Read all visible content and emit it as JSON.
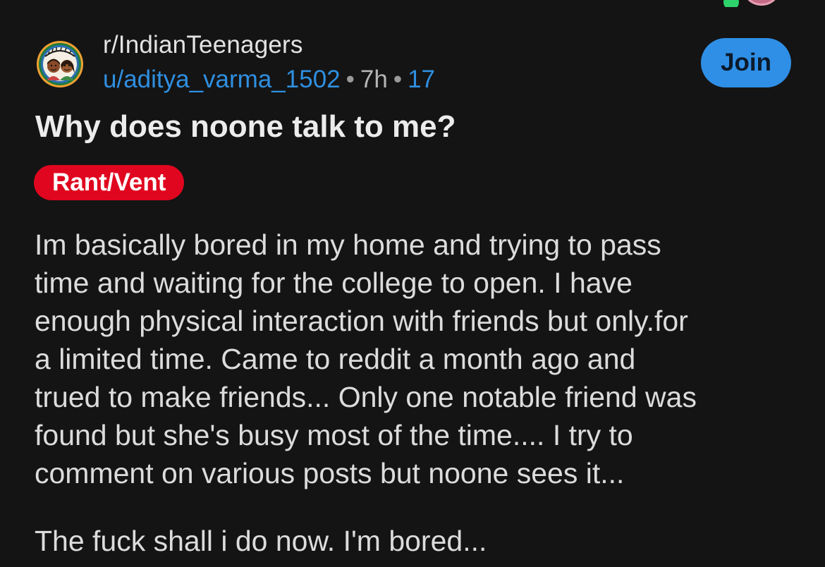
{
  "colors": {
    "background": "#141414",
    "link": "#2f8fe0",
    "join_button": "#2f8fe6",
    "flair": "#e0061f"
  },
  "header": {
    "subreddit": "r/IndianTeenagers",
    "author": "u/aditya_varma_1502",
    "separator": "•",
    "age": "7h",
    "count": "17",
    "join_label": "Join"
  },
  "post": {
    "title": "Why does noone talk to me?",
    "flair": "Rant/Vent",
    "body_lines": [
      "Im basically bored in my home and trying to pass",
      "time and waiting for the college to open. I have",
      "enough physical interaction with friends but only.for",
      "a limited time. Came to reddit a month ago and",
      "trued to make friends... Only one notable friend was",
      "found but she's busy most of the time.... I try to",
      "comment on various posts but noone sees it..."
    ],
    "closing_line": "The fuck shall i do now. I'm bored..."
  }
}
